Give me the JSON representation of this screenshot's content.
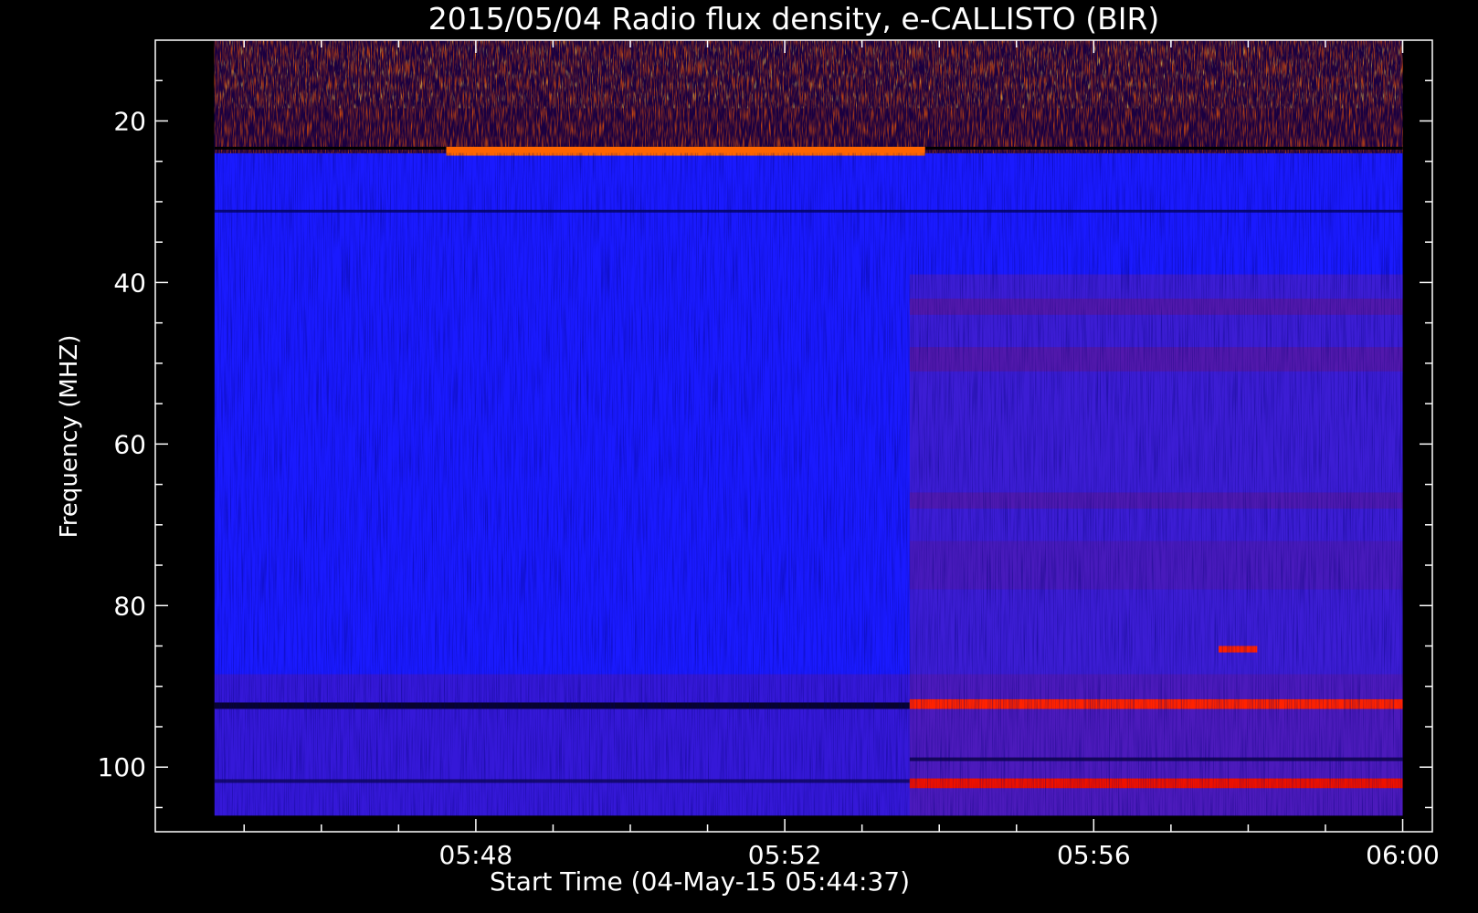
{
  "chart_data": {
    "type": "heatmap",
    "title": "2015/05/04  Radio flux density, e-CALLISTO (BIR)",
    "xlabel": "Start Time (04-May-15 05:44:37)",
    "ylabel": "Frequency (MHZ)",
    "x_ticks": [
      {
        "label": "05:48",
        "minutes": 3.383
      },
      {
        "label": "05:52",
        "minutes": 7.383
      },
      {
        "label": "05:56",
        "minutes": 11.383
      },
      {
        "label": "06:00",
        "minutes": 15.383
      }
    ],
    "y_ticks": [
      20,
      40,
      60,
      80,
      100
    ],
    "xlim_minutes": [
      -0.767,
      15.767
    ],
    "data_x_minutes": [
      0,
      15.383
    ],
    "ylim": [
      10,
      108
    ],
    "data_y": [
      10,
      106
    ],
    "colormap": [
      "#000000",
      "#0000ff",
      "#8000a0",
      "#ff0000",
      "#ffff00"
    ],
    "background_color": "#1a1aff",
    "features": [
      {
        "desc": "bright band",
        "t0": 3.0,
        "t1": 9.2,
        "f0": 23.2,
        "f1": 24.3,
        "color": "#ff6600"
      },
      {
        "desc": "red emission",
        "t0": 9.0,
        "t1": 15.383,
        "f0": 91.6,
        "f1": 92.8,
        "color": "#ff2200"
      },
      {
        "desc": "red emission",
        "t0": 9.0,
        "t1": 15.383,
        "f0": 101.4,
        "f1": 102.6,
        "color": "#ee1100"
      },
      {
        "desc": "red spot",
        "t0": 13.0,
        "t1": 13.5,
        "f0": 85.0,
        "f1": 85.8,
        "color": "#ff2200"
      }
    ]
  }
}
